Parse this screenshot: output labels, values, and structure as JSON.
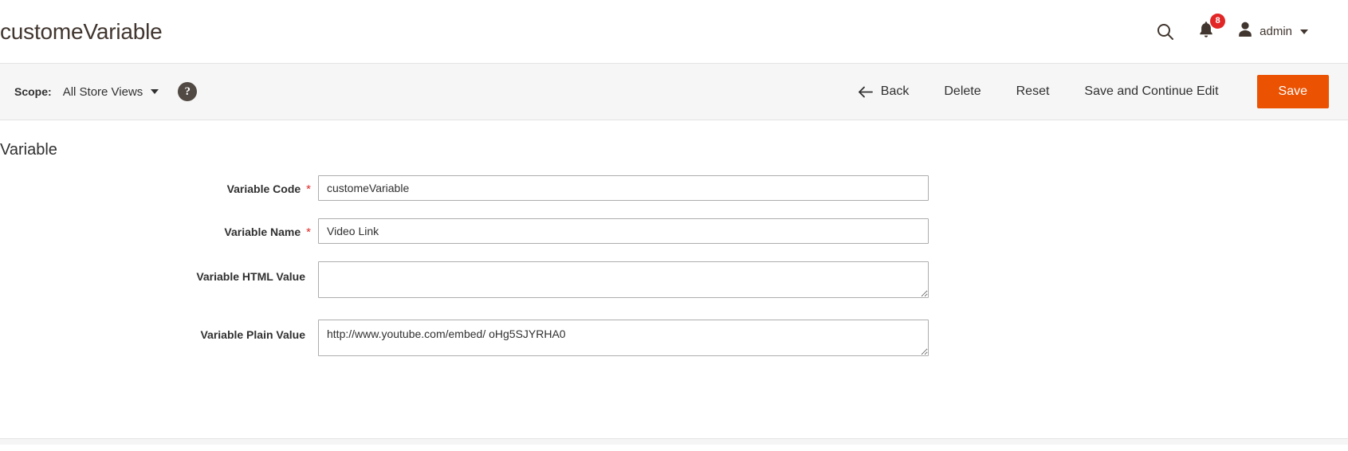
{
  "header": {
    "title": "customeVariable",
    "search_icon": "search-icon",
    "notifications": {
      "icon": "bell-icon",
      "count": "8"
    },
    "account": {
      "avatar_icon": "user-avatar-icon",
      "name": "admin",
      "caret_icon": "chevron-down-icon"
    }
  },
  "toolbar": {
    "scope_label": "Scope:",
    "scope_value": "All Store Views",
    "scope_caret_icon": "chevron-down-icon",
    "help_icon_label": "?",
    "back_label": "Back",
    "back_icon": "arrow-left-icon",
    "delete_label": "Delete",
    "reset_label": "Reset",
    "save_continue_label": "Save and Continue Edit",
    "save_label": "Save",
    "save_color": "#eb5202"
  },
  "content": {
    "section_title": "Variable",
    "fields": [
      {
        "label": "Variable Code",
        "required": "*",
        "value": "customeVariable",
        "type": "text"
      },
      {
        "label": "Variable Name",
        "required": "*",
        "value": "Video Link",
        "type": "text"
      },
      {
        "label": "Variable HTML Value",
        "required": "",
        "value": "",
        "type": "textarea"
      },
      {
        "label": "Variable Plain Value",
        "required": "",
        "value": "http://www.youtube.com/embed/ oHg5SJYRHA0",
        "type": "textarea"
      }
    ]
  }
}
